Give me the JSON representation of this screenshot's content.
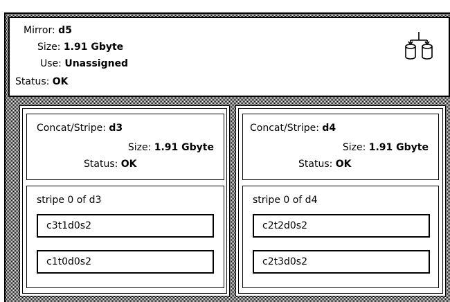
{
  "mirror": {
    "name_label": "Mirror:",
    "name": "d5",
    "size_label": "Size:",
    "size": "1.91 Gbyte",
    "use_label": "Use:",
    "use": "Unassigned",
    "status_label": "Status:",
    "status": "OK",
    "icon": "mirror-disks-icon"
  },
  "submirrors": [
    {
      "type_label": "Concat/Stripe:",
      "name": "d3",
      "size_label": "Size:",
      "size": "1.91 Gbyte",
      "status_label": "Status:",
      "status": "OK",
      "stripe_title": "stripe 0 of d3",
      "slices": [
        "c3t1d0s2",
        "c1t0d0s2"
      ]
    },
    {
      "type_label": "Concat/Stripe:",
      "name": "d4",
      "size_label": "Size:",
      "size": "1.91 Gbyte",
      "status_label": "Status:",
      "status": "OK",
      "stripe_title": "stripe 0 of d4",
      "slices": [
        "c2t2d0s2",
        "c2t3d0s2"
      ]
    }
  ]
}
